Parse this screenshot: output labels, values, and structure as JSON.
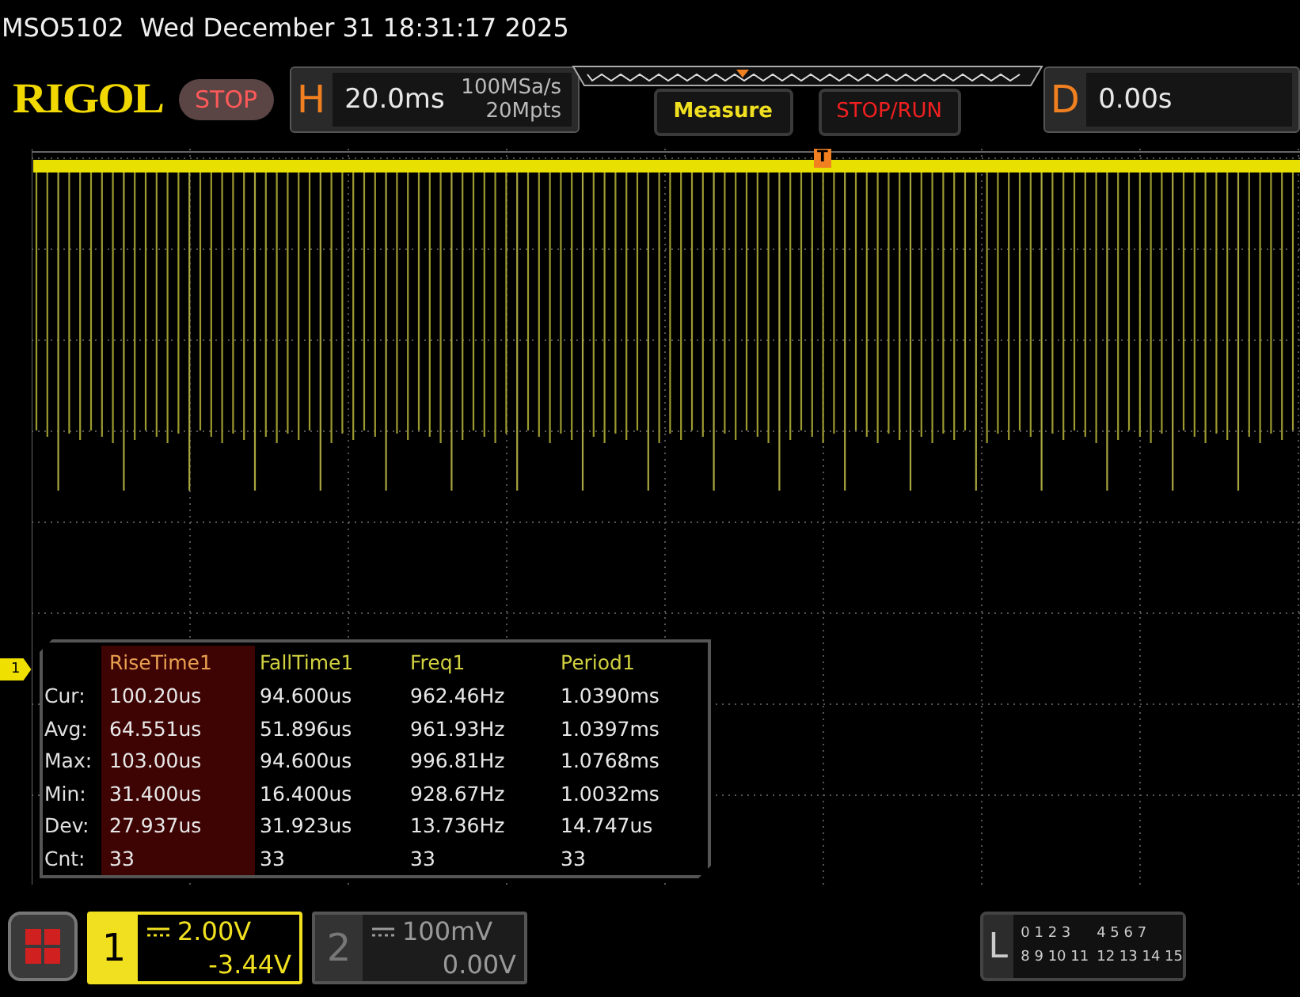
{
  "status": {
    "model": "MSO5102",
    "datetime": "Wed December 31 18:31:17 2025"
  },
  "toolbar": {
    "logo": "RIGOL",
    "run_state": "STOP",
    "horizontal": {
      "label": "H",
      "timebase": "20.0ms",
      "sample_rate": "100MSa/s",
      "memory_depth": "20Mpts"
    },
    "buttons": [
      {
        "label": "Measure",
        "kind": "menu"
      },
      {
        "label": "STOP/RUN",
        "kind": "run"
      }
    ],
    "delay": {
      "label": "D",
      "value": "0.00s"
    }
  },
  "scope": {
    "trigger_marker": "T",
    "channel_marker": "1"
  },
  "measurements": {
    "row_labels": [
      "Cur:",
      "Avg:",
      "Max:",
      "Min:",
      "Dev:",
      "Cnt:"
    ],
    "columns": [
      {
        "name": "RiseTime1",
        "selected": true,
        "values": [
          "100.20us",
          "64.551us",
          "103.00us",
          "31.400us",
          "27.937us",
          "33"
        ]
      },
      {
        "name": "FallTime1",
        "selected": false,
        "values": [
          "94.600us",
          "51.896us",
          "94.600us",
          "16.400us",
          "31.923us",
          "33"
        ]
      },
      {
        "name": "Freq1",
        "selected": false,
        "values": [
          "962.46Hz",
          "961.93Hz",
          "996.81Hz",
          "928.67Hz",
          "13.736Hz",
          "33"
        ]
      },
      {
        "name": "Period1",
        "selected": false,
        "values": [
          "1.0390ms",
          "1.0397ms",
          "1.0768ms",
          "1.0032ms",
          "14.747us",
          "33"
        ]
      }
    ]
  },
  "channels": [
    {
      "number": "1",
      "active": true,
      "scale": "2.00V",
      "offset": "-3.44V"
    },
    {
      "number": "2",
      "active": false,
      "scale": "100mV",
      "offset": "0.00V"
    }
  ],
  "logic": {
    "label": "L",
    "bits": [
      [
        "0",
        "1",
        "2",
        "3"
      ],
      [
        "4",
        "5",
        "6",
        "7"
      ],
      [
        "8",
        "9",
        "10",
        "11"
      ],
      [
        "12",
        "13",
        "14",
        "15"
      ]
    ]
  }
}
